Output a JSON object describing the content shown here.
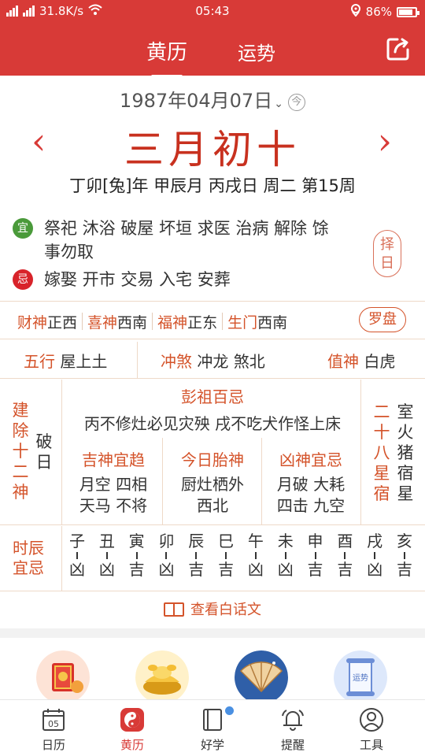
{
  "status_bar": {
    "left": "31.8K/s",
    "time": "05:43",
    "battery": "86%",
    "battery_level": 0.86
  },
  "header": {
    "tabs": [
      {
        "label": "黄历",
        "active": true
      },
      {
        "label": "运势",
        "active": false
      }
    ]
  },
  "date": {
    "solar": "1987年04月07日",
    "chevron": "⌄",
    "today_badge": "今",
    "lunar": "三月初十",
    "prev": "‹",
    "next": "›",
    "ganzhi": "丁卯[兔]年 甲辰月 丙戌日 周二 第15周"
  },
  "yi": {
    "badge": "宜",
    "line1": "祭祀 沐浴 破屋 坏垣 求医 治病 解除 馀",
    "line2": "事勿取",
    "color": "#4a9a3a"
  },
  "ji": {
    "badge": "忌",
    "text": "嫁娶 开市 交易 入宅 安葬",
    "color": "#d8232a"
  },
  "zeri": "择日",
  "gods": [
    {
      "key": "财神",
      "value": "正西"
    },
    {
      "key": "喜神",
      "value": "西南"
    },
    {
      "key": "福神",
      "value": "正东"
    },
    {
      "key": "生门",
      "value": "西南"
    }
  ],
  "luopan": "罗盘",
  "row3": {
    "wuxing_key": "五行",
    "wuxing_val": "屋上土",
    "chongsha_key": "冲煞",
    "chongsha_val": "冲龙 煞北",
    "zhishen_key": "值神",
    "zhishen_val": "白虎"
  },
  "jianchu": {
    "label": [
      "建",
      "除",
      "十",
      "二",
      "神"
    ],
    "value": [
      "破",
      "日"
    ]
  },
  "pengzu": {
    "title": "彭祖百忌",
    "text": "丙不修灶必见灾殃 戌不吃犬作怪上床"
  },
  "jishen": {
    "title": "吉神宜趋",
    "l1": "月空 四相",
    "l2": "天马 不将"
  },
  "taishen": {
    "title": "今日胎神",
    "l1": "厨灶栖外",
    "l2": "西北"
  },
  "xiongshen": {
    "title": "凶神宜忌",
    "l1": "月破 大耗",
    "l2": "四击 九空"
  },
  "xiu": {
    "label": [
      "二",
      "十",
      "八",
      "星",
      "宿"
    ],
    "value": [
      "室",
      "火",
      "猪",
      "宿",
      "星"
    ]
  },
  "shichen_label": [
    "时辰",
    "宜忌"
  ],
  "shichen": [
    {
      "zhi": "子",
      "luck": "凶"
    },
    {
      "zhi": "丑",
      "luck": "凶"
    },
    {
      "zhi": "寅",
      "luck": "吉"
    },
    {
      "zhi": "卯",
      "luck": "凶"
    },
    {
      "zhi": "辰",
      "luck": "吉"
    },
    {
      "zhi": "巳",
      "luck": "吉"
    },
    {
      "zhi": "午",
      "luck": "凶"
    },
    {
      "zhi": "未",
      "luck": "凶"
    },
    {
      "zhi": "申",
      "luck": "吉"
    },
    {
      "zhi": "酉",
      "luck": "吉"
    },
    {
      "zhi": "戌",
      "luck": "凶"
    },
    {
      "zhi": "亥",
      "luck": "吉"
    }
  ],
  "baihua": "查看白话文",
  "features": [
    {
      "icon": "red-almanac-book-icon"
    },
    {
      "icon": "gold-ingot-icon"
    },
    {
      "icon": "folding-fan-icon"
    },
    {
      "icon": "fortune-scroll-icon",
      "text": "运势"
    }
  ],
  "bottom_nav": [
    {
      "label": "日历",
      "icon": "calendar-icon",
      "day": "05"
    },
    {
      "label": "黄历",
      "icon": "yin-yang-icon",
      "active": true
    },
    {
      "label": "好学",
      "icon": "book-icon",
      "has_dot": true
    },
    {
      "label": "提醒",
      "icon": "bell-icon"
    },
    {
      "label": "工具",
      "icon": "person-icon"
    }
  ],
  "colors": {
    "brand_red": "#d83a37",
    "accent_orange": "#d4532a",
    "lunar_red": "#c8311f"
  }
}
